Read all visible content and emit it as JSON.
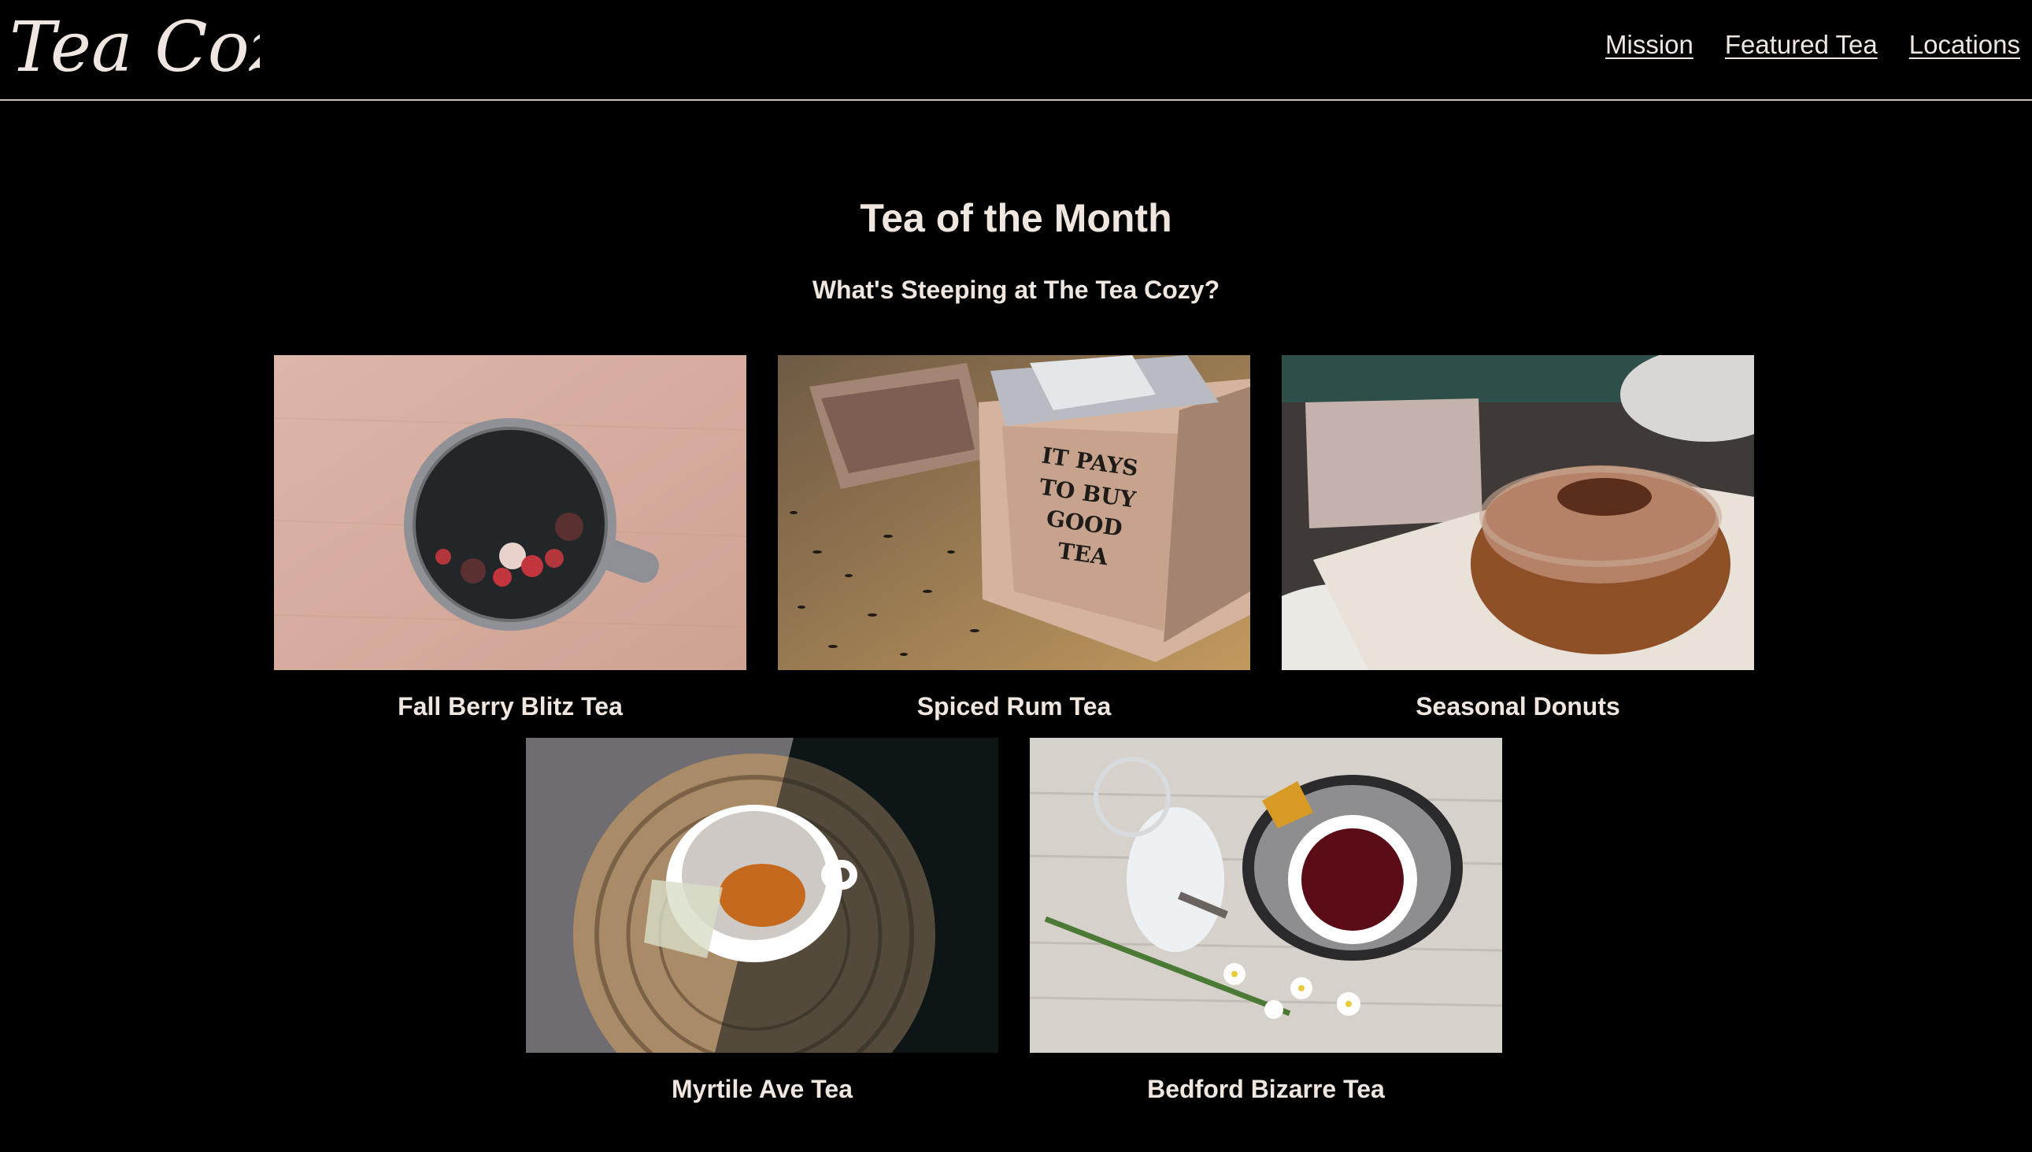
{
  "brand": {
    "logo_text": "Tea Cozy"
  },
  "nav": {
    "items": [
      {
        "label": "Mission"
      },
      {
        "label": "Featured Tea"
      },
      {
        "label": "Locations"
      }
    ]
  },
  "main": {
    "title": "Tea of the Month",
    "subtitle": "What's Steeping at The Tea Cozy?",
    "teas": [
      {
        "name": "Fall Berry Blitz Tea"
      },
      {
        "name": "Spiced Rum Tea"
      },
      {
        "name": "Seasonal Donuts"
      },
      {
        "name": "Myrtile Ave Tea"
      },
      {
        "name": "Bedford Bizarre Tea"
      }
    ]
  },
  "colors": {
    "background": "#000000",
    "text": "#f0e6e0",
    "header_border": "#c9c1bc"
  }
}
